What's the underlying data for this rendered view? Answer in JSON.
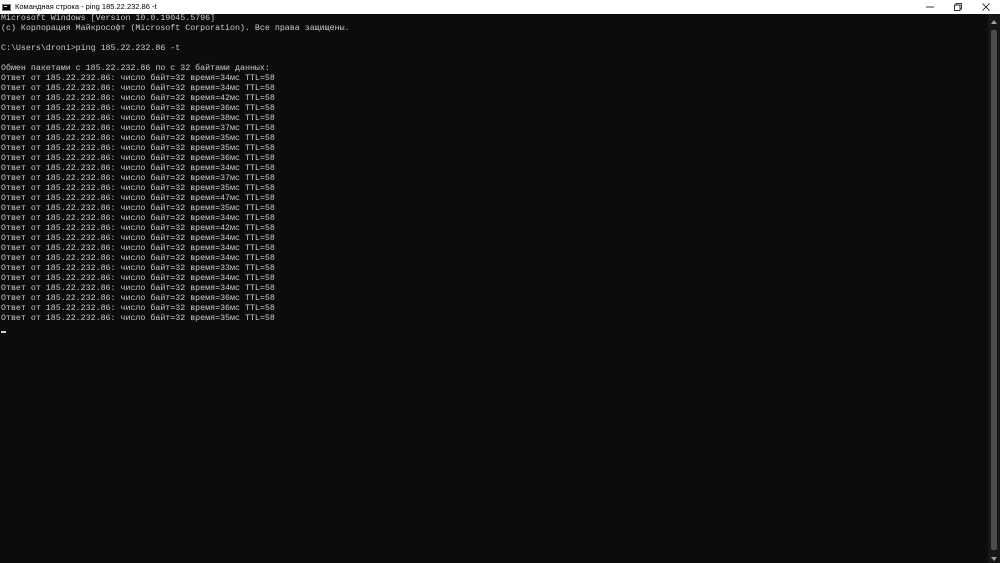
{
  "window": {
    "title": "Командная строка - ping  185.22.232.86 -t",
    "icon": "cmd-icon",
    "buttons": {
      "minimize_icon": "minimize-icon",
      "maximize_icon": "restore-icon",
      "close_icon": "close-icon"
    }
  },
  "console": {
    "lines": [
      "Microsoft Windows [Version 10.0.19045.5796]",
      "(c) Корпорация Майкрософт (Microsoft Corporation). Все права защищены.",
      "",
      "C:\\Users\\droni>ping 185.22.232.86 -t",
      "",
      "Обмен пакетами с 185.22.232.86 по с 32 байтами данных:",
      "Ответ от 185.22.232.86: число байт=32 время=34мс TTL=58",
      "Ответ от 185.22.232.86: число байт=32 время=34мс TTL=58",
      "Ответ от 185.22.232.86: число байт=32 время=42мс TTL=58",
      "Ответ от 185.22.232.86: число байт=32 время=36мс TTL=58",
      "Ответ от 185.22.232.86: число байт=32 время=38мс TTL=58",
      "Ответ от 185.22.232.86: число байт=32 время=37мс TTL=58",
      "Ответ от 185.22.232.86: число байт=32 время=35мс TTL=58",
      "Ответ от 185.22.232.86: число байт=32 время=35мс TTL=58",
      "Ответ от 185.22.232.86: число байт=32 время=36мс TTL=58",
      "Ответ от 185.22.232.86: число байт=32 время=34мс TTL=58",
      "Ответ от 185.22.232.86: число байт=32 время=37мс TTL=58",
      "Ответ от 185.22.232.86: число байт=32 время=35мс TTL=58",
      "Ответ от 185.22.232.86: число байт=32 время=47мс TTL=58",
      "Ответ от 185.22.232.86: число байт=32 время=35мс TTL=58",
      "Ответ от 185.22.232.86: число байт=32 время=34мс TTL=58",
      "Ответ от 185.22.232.86: число байт=32 время=42мс TTL=58",
      "Ответ от 185.22.232.86: число байт=32 время=34мс TTL=58",
      "Ответ от 185.22.232.86: число байт=32 время=34мс TTL=58",
      "Ответ от 185.22.232.86: число байт=32 время=34мс TTL=58",
      "Ответ от 185.22.232.86: число байт=32 время=33мс TTL=58",
      "Ответ от 185.22.232.86: число байт=32 время=34мс TTL=58",
      "Ответ от 185.22.232.86: число байт=32 время=34мс TTL=58",
      "Ответ от 185.22.232.86: число байт=32 время=36мс TTL=58",
      "Ответ от 185.22.232.86: число байт=32 время=36мс TTL=58",
      "Ответ от 185.22.232.86: число байт=32 время=35мс TTL=58"
    ]
  },
  "colors": {
    "background": "#0c0c0c",
    "text": "#cccccc",
    "titlebar": "#ffffff"
  }
}
